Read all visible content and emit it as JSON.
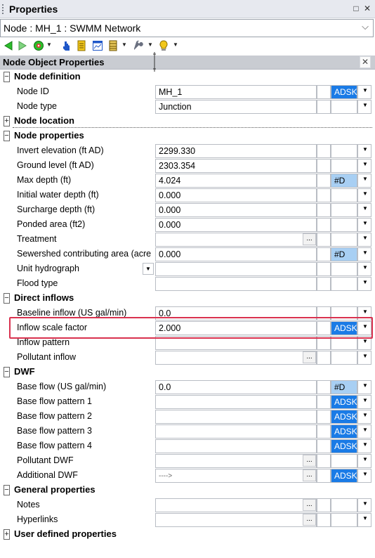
{
  "window": {
    "title": "Properties",
    "restore_glyph": "□",
    "close_glyph": "✕"
  },
  "node_selector": {
    "value": "Node : MH_1 : SWMM Network",
    "chevron": "⌵"
  },
  "toolbar": {
    "icons": [
      "back-arrow-icon",
      "forward-arrow-icon",
      "color-wheel-icon",
      "pointer-hand-icon",
      "document-icon",
      "chart-window-icon",
      "database-icon",
      "wrench-icon",
      "help-bulb-icon"
    ],
    "colors": {
      "green": "#2cbd2c",
      "blue": "#1f57c9",
      "yellow": "#f2c71a"
    }
  },
  "panel": {
    "title": "Node Object Properties",
    "close_glyph": "✕"
  },
  "accent_colors": {
    "adsk_bg": "#1a7be6",
    "hd_bg": "#a8cff3",
    "highlight": "#d9324f"
  },
  "sections": {
    "node_definition": {
      "label": "Node definition",
      "toggle": "−"
    },
    "node_location": {
      "label": "Node location",
      "toggle": "+"
    },
    "node_properties": {
      "label": "Node properties",
      "toggle": "−"
    },
    "direct_inflows": {
      "label": "Direct inflows",
      "toggle": "−"
    },
    "dwf": {
      "label": "DWF",
      "toggle": "−"
    },
    "general_properties": {
      "label": "General properties",
      "toggle": "−"
    },
    "user_defined": {
      "label": "User defined properties",
      "toggle": "+"
    }
  },
  "props": {
    "node_id": {
      "label": "Node ID",
      "value": "MH_1",
      "badge": "ADSK"
    },
    "node_type": {
      "label": "Node type",
      "value": "Junction"
    },
    "invert_elevation": {
      "label": "Invert elevation (ft AD)",
      "value": "2299.330"
    },
    "ground_level": {
      "label": "Ground level (ft AD)",
      "value": "2303.354"
    },
    "max_depth": {
      "label": "Max depth (ft)",
      "value": "4.024",
      "badge": "#D"
    },
    "initial_water_depth": {
      "label": "Initial water depth (ft)",
      "value": "0.000"
    },
    "surcharge_depth": {
      "label": "Surcharge depth (ft)",
      "value": "0.000"
    },
    "ponded_area": {
      "label": "Ponded area (ft2)",
      "value": "0.000"
    },
    "treatment": {
      "label": "Treatment",
      "value": ""
    },
    "sewershed_area": {
      "label": "Sewershed contributing area (acre",
      "value": "0.000",
      "badge": "#D"
    },
    "unit_hydrograph": {
      "label": "Unit hydrograph",
      "value": ""
    },
    "flood_type": {
      "label": "Flood type",
      "value": ""
    },
    "baseline_inflow": {
      "label": "Baseline inflow (US gal/min)",
      "value": "0.0"
    },
    "inflow_scale_factor": {
      "label": "Inflow scale factor",
      "value": "2.000",
      "badge": "ADSK"
    },
    "inflow_pattern": {
      "label": "Inflow pattern",
      "value": ""
    },
    "pollutant_inflow": {
      "label": "Pollutant inflow",
      "value": ""
    },
    "base_flow": {
      "label": "Base flow (US gal/min)",
      "value": "0.0",
      "badge": "#D"
    },
    "base_flow_pattern_1": {
      "label": "Base flow pattern 1",
      "value": "",
      "badge": "ADSK"
    },
    "base_flow_pattern_2": {
      "label": "Base flow pattern 2",
      "value": "",
      "badge": "ADSK"
    },
    "base_flow_pattern_3": {
      "label": "Base flow pattern 3",
      "value": "",
      "badge": "ADSK"
    },
    "base_flow_pattern_4": {
      "label": "Base flow pattern 4",
      "value": "",
      "badge": "ADSK"
    },
    "pollutant_dwf": {
      "label": "Pollutant DWF",
      "value": ""
    },
    "additional_dwf": {
      "label": "Additional DWF",
      "value": "---->",
      "badge": "ADSK"
    },
    "notes": {
      "label": "Notes",
      "value": ""
    },
    "hyperlinks": {
      "label": "Hyperlinks",
      "value": ""
    }
  },
  "glyphs": {
    "ellipsis": "...",
    "dropdown": "▼"
  }
}
